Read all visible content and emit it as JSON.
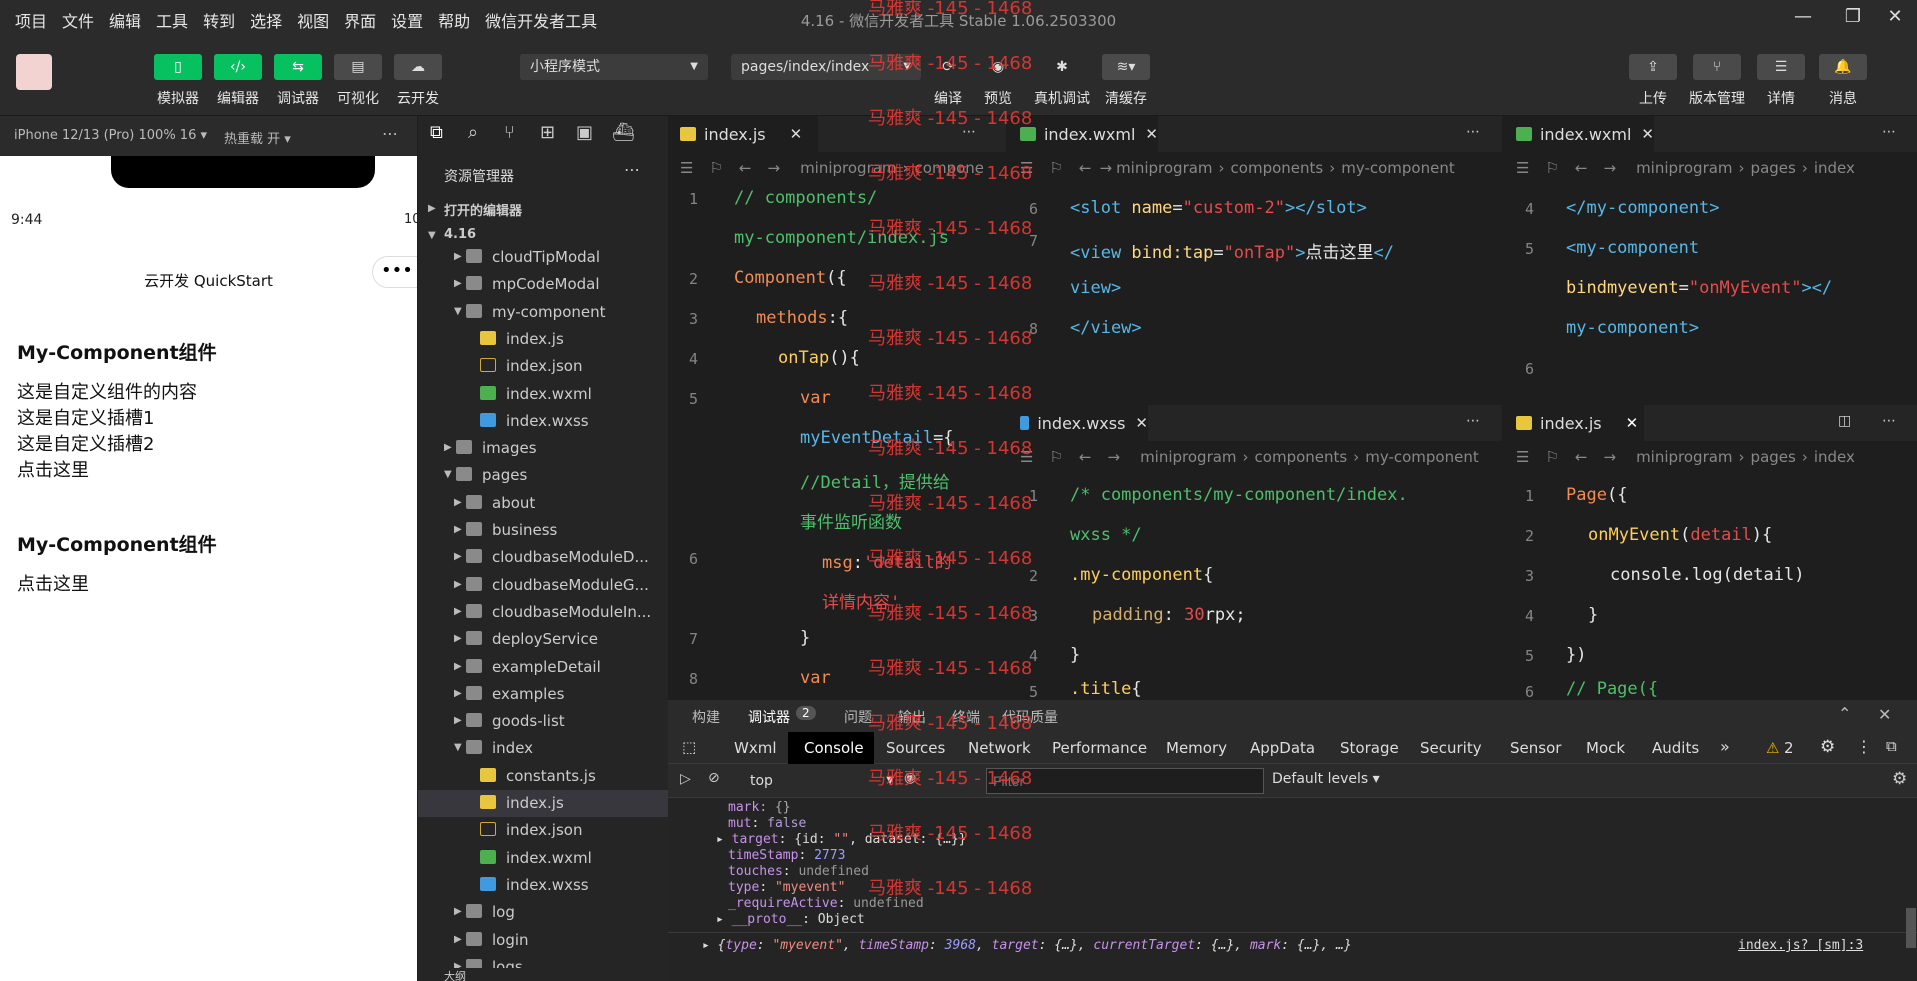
{
  "menu": {
    "items": [
      "项目",
      "文件",
      "编辑",
      "工具",
      "转到",
      "选择",
      "视图",
      "界面",
      "设置",
      "帮助",
      "微信开发者工具"
    ],
    "window_title": "4.16 - 微信开发者工具 Stable 1.06.2503300"
  },
  "toolbar": {
    "left_buttons": [
      "模拟器",
      "编辑器",
      "调试器",
      "可视化",
      "云开发"
    ],
    "mode_select": "小程序模式",
    "page_select": "pages/index/index",
    "mid_buttons": [
      "编译",
      "预览",
      "真机调试",
      "清缓存"
    ],
    "right_buttons": [
      "上传",
      "版本管理",
      "详情",
      "消息"
    ]
  },
  "simulator": {
    "device": "iPhone 12/13 (Pro) 100% 16 ▾",
    "hot_reload": "热重载 开 ▾",
    "time": "9:44",
    "battery": "10",
    "nav_title": "云开发 QuickStart",
    "content": [
      "My-Component组件",
      "这是自定义组件的内容",
      "这是自定义插槽1",
      "这是自定义插槽2",
      "点击这里",
      "My-Component组件",
      "点击这里"
    ]
  },
  "explorer": {
    "title": "资源管理器",
    "open_editors": "打开的编辑器",
    "root": "4.16",
    "outline": "大纲",
    "rows": [
      {
        "label": "cloudTipModal",
        "type": "folder"
      },
      {
        "label": "mpCodeModal",
        "type": "folder"
      },
      {
        "label": "my-component",
        "type": "folder"
      },
      {
        "label": "index.js",
        "type": "js"
      },
      {
        "label": "index.json",
        "type": "json"
      },
      {
        "label": "index.wxml",
        "type": "wxml"
      },
      {
        "label": "index.wxss",
        "type": "wxss"
      },
      {
        "label": "images",
        "type": "folder"
      },
      {
        "label": "pages",
        "type": "folder"
      },
      {
        "label": "about",
        "type": "folder"
      },
      {
        "label": "business",
        "type": "folder"
      },
      {
        "label": "cloudbaseModuleD...",
        "type": "folder"
      },
      {
        "label": "cloudbaseModuleG...",
        "type": "folder"
      },
      {
        "label": "cloudbaseModuleIn...",
        "type": "folder"
      },
      {
        "label": "deployService",
        "type": "folder"
      },
      {
        "label": "exampleDetail",
        "type": "folder"
      },
      {
        "label": "examples",
        "type": "folder"
      },
      {
        "label": "goods-list",
        "type": "folder"
      },
      {
        "label": "index",
        "type": "folder"
      },
      {
        "label": "constants.js",
        "type": "js"
      },
      {
        "label": "index.js",
        "type": "js"
      },
      {
        "label": "index.json",
        "type": "json"
      },
      {
        "label": "index.wxml",
        "type": "wxml"
      },
      {
        "label": "index.wxss",
        "type": "wxss"
      },
      {
        "label": "log",
        "type": "folder"
      },
      {
        "label": "login",
        "type": "folder"
      },
      {
        "label": "logs",
        "type": "folder"
      }
    ]
  },
  "editors": {
    "ed1": {
      "tab": "index.js",
      "crumb": [
        "miniprogram",
        "compone"
      ],
      "lines": [
        "1",
        "2",
        "3",
        "4",
        "5",
        "6",
        "7",
        "8"
      ]
    },
    "ed2": {
      "tab": "index.wxml",
      "crumb": [
        "miniprogram",
        "components",
        "my-component"
      ],
      "lines": [
        "6",
        "7",
        "8"
      ]
    },
    "ed3": {
      "tab": "index.wxml",
      "crumb": [
        "miniprogram",
        "pages",
        "index"
      ],
      "lines": [
        "4",
        "5",
        "6"
      ]
    },
    "ed4": {
      "tab": "index.wxss",
      "crumb": [
        "miniprogram",
        "components",
        "my-component"
      ],
      "lines": [
        "1",
        "2",
        "3",
        "4",
        "5"
      ]
    },
    "ed5": {
      "tab": "index.js",
      "crumb": [
        "miniprogram",
        "pages",
        "index"
      ],
      "lines": [
        "1",
        "2",
        "3",
        "4",
        "5",
        "6"
      ]
    }
  },
  "devtools": {
    "tabs": [
      "构建",
      "调试器",
      "问题",
      "输出",
      "终端",
      "代码质量"
    ],
    "debugger_badge": "2",
    "panels": [
      "Wxml",
      "Console",
      "Sources",
      "Network",
      "Performance",
      "Memory",
      "AppData",
      "Storage",
      "Security",
      "Sensor",
      "Mock",
      "Audits"
    ],
    "more": "»",
    "warn_count": "2",
    "context": "top",
    "filter_placeholder": "Filter",
    "levels": "Default levels ▾",
    "source_link": "index.js? [sm]:3"
  },
  "watermark": "马雅爽 -145 - 1468",
  "colors": {
    "accent_green": "#07c160",
    "bg_dark": "#1e1e1e",
    "toolbar": "#2b2b2b"
  }
}
